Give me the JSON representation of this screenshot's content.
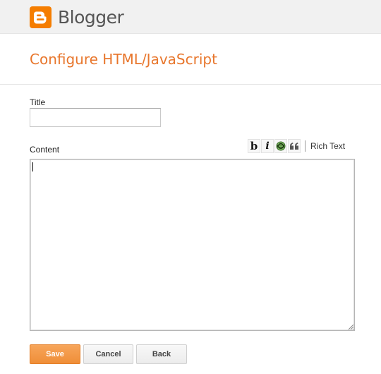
{
  "app": {
    "brand_name": "Blogger",
    "brand_color": "#f57d00"
  },
  "page": {
    "title": "Configure HTML/JavaScript",
    "accent_color": "#e8762c"
  },
  "form": {
    "title_label": "Title",
    "title_value": "",
    "content_label": "Content",
    "content_value": ""
  },
  "toolbar": {
    "bold_label": "b",
    "italic_label": "i",
    "link_icon": "link-icon",
    "quote_icon": "quote-icon",
    "rich_text_label": "Rich Text"
  },
  "buttons": {
    "save_label": "Save",
    "cancel_label": "Cancel",
    "back_label": "Back"
  }
}
